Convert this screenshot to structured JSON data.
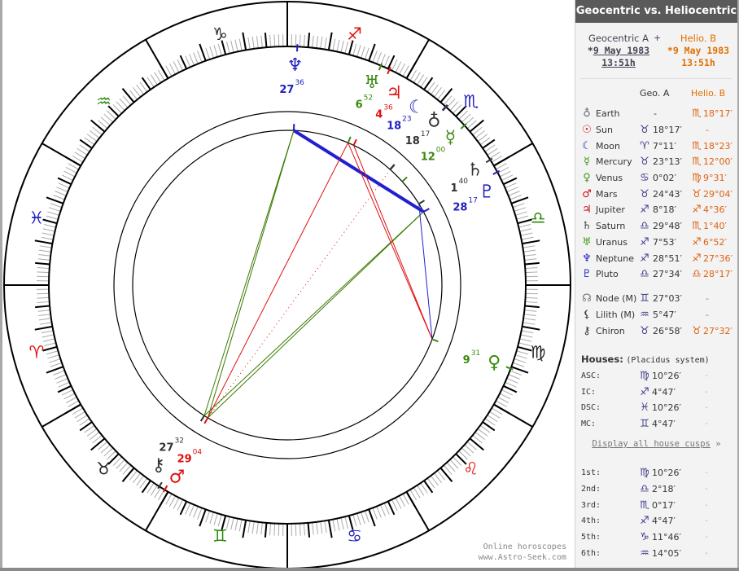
{
  "panel": {
    "title": "Geocentric vs. Heliocentric",
    "chart_a": {
      "label": "Geocentric A",
      "date": "9 May 1983",
      "date_prefix": "*",
      "time": "13:51h"
    },
    "plus": "+",
    "chart_b": {
      "label": "Helio. B",
      "date": "*9 May 1983",
      "time": "13:51h"
    },
    "col_a": "Geo. A",
    "col_b": "Helio. B",
    "planets": [
      {
        "key": "earth",
        "glyph": "♁",
        "name": "Earth",
        "color": "#666666",
        "geo_sign": "",
        "geo": "-",
        "helio_sign": "♏",
        "helio": "18°17′"
      },
      {
        "key": "sun",
        "glyph": "☉",
        "name": "Sun",
        "color": "#d01010",
        "geo_sign": "♉",
        "geo": "18°17′",
        "helio_sign": "",
        "helio": "-"
      },
      {
        "key": "moon",
        "glyph": "☾",
        "name": "Moon",
        "color": "#2020c0",
        "geo_sign": "♈",
        "geo": "7°11′",
        "helio_sign": "♏",
        "helio": "18°23′"
      },
      {
        "key": "mercury",
        "glyph": "☿",
        "name": "Mercury",
        "color": "#3a9a10",
        "geo_sign": "♉",
        "geo": "23°13′",
        "helio_sign": "♏",
        "helio": "12°00′"
      },
      {
        "key": "venus",
        "glyph": "♀",
        "name": "Venus",
        "color": "#3a9a10",
        "geo_sign": "♋",
        "geo": "0°02′",
        "helio_sign": "♍",
        "helio": "9°31′"
      },
      {
        "key": "mars",
        "glyph": "♂",
        "name": "Mars",
        "color": "#d01010",
        "geo_sign": "♉",
        "geo": "24°43′",
        "helio_sign": "♉",
        "helio": "29°04′"
      },
      {
        "key": "jupiter",
        "glyph": "♃",
        "name": "Jupiter",
        "color": "#d01010",
        "geo_sign": "♐",
        "geo": "8°18′",
        "helio_sign": "♐",
        "helio": "4°36′"
      },
      {
        "key": "saturn",
        "glyph": "♄",
        "name": "Saturn",
        "color": "#444444",
        "geo_sign": "♎",
        "geo": "29°48′",
        "helio_sign": "♏",
        "helio": "1°40′"
      },
      {
        "key": "uranus",
        "glyph": "♅",
        "name": "Uranus",
        "color": "#3a9a10",
        "geo_sign": "♐",
        "geo": "7°53′",
        "helio_sign": "♐",
        "helio": "6°52′"
      },
      {
        "key": "neptune",
        "glyph": "♆",
        "name": "Neptune",
        "color": "#2020c0",
        "geo_sign": "♐",
        "geo": "28°51′",
        "helio_sign": "♐",
        "helio": "27°36′"
      },
      {
        "key": "pluto",
        "glyph": "♇",
        "name": "Pluto",
        "color": "#2020c0",
        "geo_sign": "♎",
        "geo": "27°34′",
        "helio_sign": "♎",
        "helio": "28°17′"
      }
    ],
    "points": [
      {
        "glyph": "☊",
        "name": "Node (M)",
        "color": "#777777",
        "geo_sign": "♊",
        "geo": "27°03′",
        "helio_sign": "",
        "helio": "-"
      },
      {
        "glyph": "⚸",
        "name": "Lilith (M)",
        "color": "#333333",
        "geo_sign": "♒",
        "geo": "5°47′",
        "helio_sign": "",
        "helio": "-"
      },
      {
        "glyph": "⚷",
        "name": "Chiron",
        "color": "#333333",
        "geo_sign": "♉",
        "geo": "26°58′",
        "helio_sign": "♉",
        "helio": "27°32′"
      }
    ],
    "houses_title": "Houses:",
    "houses_system": "(Placidus system)",
    "angles": [
      {
        "label": "ASC:",
        "sign": "♍",
        "value": "10°26′",
        "b": "-"
      },
      {
        "label": "IC:",
        "sign": "♐",
        "value": "4°47′",
        "b": "-"
      },
      {
        "label": "DSC:",
        "sign": "♓",
        "value": "10°26′",
        "b": "-"
      },
      {
        "label": "MC:",
        "sign": "♊",
        "value": "4°47′",
        "b": "-"
      }
    ],
    "cusps_link": "Display all house cusps",
    "cusps_arrow": "»",
    "cusps": [
      {
        "label": "1st:",
        "sign": "♍",
        "value": "10°26′",
        "b": "-"
      },
      {
        "label": "2nd:",
        "sign": "♎",
        "value": "2°18′",
        "b": "-"
      },
      {
        "label": "3rd:",
        "sign": "♏",
        "value": "0°17′",
        "b": "-"
      },
      {
        "label": "4th:",
        "sign": "♐",
        "value": "4°47′",
        "b": "-"
      },
      {
        "label": "5th:",
        "sign": "♑",
        "value": "11°46′",
        "b": "-"
      },
      {
        "label": "6th:",
        "sign": "♒",
        "value": "14°05′",
        "b": "-"
      }
    ]
  },
  "footer": {
    "line1": "Online horoscopes",
    "line2": "www.Astro-Seek.com"
  },
  "wheel": {
    "signs": [
      {
        "glyph": "♈",
        "color": "#e01010"
      },
      {
        "glyph": "♉",
        "color": "#222222"
      },
      {
        "glyph": "♊",
        "color": "#2a8a10"
      },
      {
        "glyph": "♋",
        "color": "#2020c0"
      },
      {
        "glyph": "♌",
        "color": "#e01010"
      },
      {
        "glyph": "♍",
        "color": "#222222"
      },
      {
        "glyph": "♎",
        "color": "#2a8a10"
      },
      {
        "glyph": "♏",
        "color": "#2020c0"
      },
      {
        "glyph": "♐",
        "color": "#e01010"
      },
      {
        "glyph": "♑",
        "color": "#222222"
      },
      {
        "glyph": "♒",
        "color": "#2a8a10"
      },
      {
        "glyph": "♓",
        "color": "#2020c0"
      }
    ],
    "bodies": [
      {
        "key": "neptune",
        "glyph": "♆",
        "color": "#2020c0",
        "lon": 267.6,
        "deg": "27",
        "min": "36"
      },
      {
        "key": "uranus",
        "glyph": "♅",
        "color": "#3a8a10",
        "lon": 246.87,
        "deg": "6",
        "min": "52"
      },
      {
        "key": "jupiter",
        "glyph": "♃",
        "color": "#e01010",
        "lon": 244.6,
        "deg": "4",
        "min": "36"
      },
      {
        "key": "moon",
        "glyph": "☾",
        "color": "#2020c0",
        "lon": 228.38,
        "deg": "18",
        "min": "23"
      },
      {
        "key": "earth",
        "glyph": "♁",
        "color": "#333333",
        "lon": 228.28,
        "deg": "18",
        "min": "17"
      },
      {
        "key": "mercury",
        "glyph": "☿",
        "color": "#3a8a10",
        "lon": 222.0,
        "deg": "12",
        "min": "00"
      },
      {
        "key": "saturn",
        "glyph": "♄",
        "color": "#333333",
        "lon": 211.67,
        "deg": "1",
        "min": "40"
      },
      {
        "key": "pluto",
        "glyph": "♇",
        "color": "#2020c0",
        "lon": 208.28,
        "deg": "28",
        "min": "17"
      },
      {
        "key": "venus",
        "glyph": "♀",
        "color": "#3a8a10",
        "lon": 159.52,
        "deg": "9",
        "min": "31"
      },
      {
        "key": "chiron",
        "glyph": "⚷",
        "color": "#333333",
        "lon": 57.53,
        "deg": "27",
        "min": "32"
      },
      {
        "key": "mars",
        "glyph": "♂",
        "color": "#e01010",
        "lon": 59.07,
        "deg": "29",
        "min": "04"
      }
    ],
    "aspects": [
      {
        "a": "neptune",
        "b": "pluto",
        "color": "#2020d0",
        "style": "thick"
      },
      {
        "a": "neptune",
        "b": "mars",
        "color": "#3a7a00",
        "style": "thin"
      },
      {
        "a": "neptune",
        "b": "chiron",
        "color": "#3a7a00",
        "style": "thin"
      },
      {
        "a": "pluto",
        "b": "mars",
        "color": "#3a7a00",
        "style": "thin"
      },
      {
        "a": "pluto",
        "b": "chiron",
        "color": "#3a7a00",
        "style": "thin"
      },
      {
        "a": "uranus",
        "b": "mars",
        "color": "#e01010",
        "style": "thin"
      },
      {
        "a": "uranus",
        "b": "venus",
        "color": "#e01010",
        "style": "thin"
      },
      {
        "a": "jupiter",
        "b": "venus",
        "color": "#e01010",
        "style": "thin"
      },
      {
        "a": "saturn",
        "b": "venus",
        "color": "#2020d0",
        "style": "thin"
      },
      {
        "a": "earth",
        "b": "mars",
        "color": "#e01010",
        "style": "dotted"
      }
    ]
  }
}
